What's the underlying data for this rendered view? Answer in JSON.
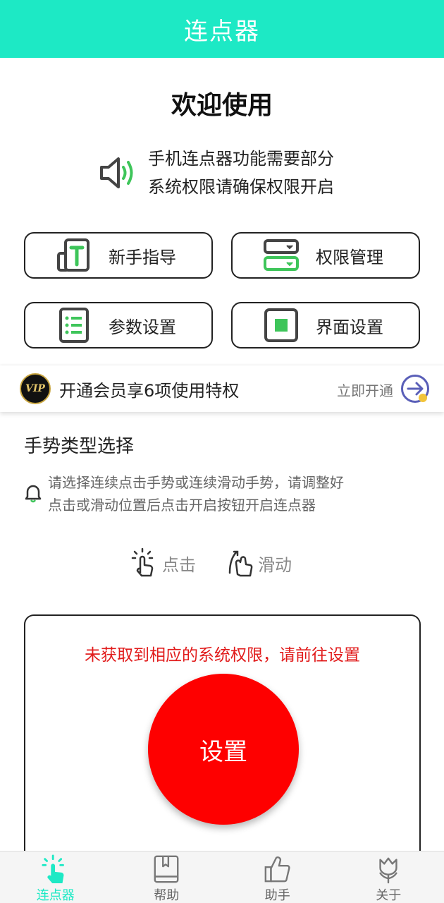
{
  "app_bar": {
    "title": "连点器"
  },
  "welcome": "欢迎使用",
  "notice": {
    "line1": "手机连点器功能需要部分",
    "line2": "系统权限请确保权限开启"
  },
  "tiles": [
    {
      "label": "新手指导",
      "icon": "guide-icon"
    },
    {
      "label": "权限管理",
      "icon": "permission-icon"
    },
    {
      "label": "参数设置",
      "icon": "list-icon"
    },
    {
      "label": "界面设置",
      "icon": "interface-icon"
    }
  ],
  "vip": {
    "badge": "VIP",
    "text": "开通会员享6项使用特权",
    "action": "立即开通"
  },
  "gesture_section": {
    "title": "手势类型选择",
    "hint_line1": "请选择连续点击手势或连续滑动手势，请调整好",
    "hint_line2": "点击或滑动位置后点击开启按钮开启连点器",
    "options": [
      {
        "label": "点击",
        "icon": "tap-hand-icon"
      },
      {
        "label": "滑动",
        "icon": "swipe-hand-icon"
      }
    ]
  },
  "panel": {
    "warning": "未获取到相应的系统权限，请前往设置",
    "button": "设置"
  },
  "bottom_nav": [
    {
      "label": "连点器",
      "icon": "tap-hand-icon",
      "active": true
    },
    {
      "label": "帮助",
      "icon": "book-icon",
      "active": false
    },
    {
      "label": "助手",
      "icon": "thumbs-up-icon",
      "active": false
    },
    {
      "label": "关于",
      "icon": "tulip-icon",
      "active": false
    }
  ],
  "colors": {
    "accent": "#1de9c5",
    "green": "#3ec55a",
    "danger": "#fe0000",
    "warning_text": "#e11b1b"
  }
}
